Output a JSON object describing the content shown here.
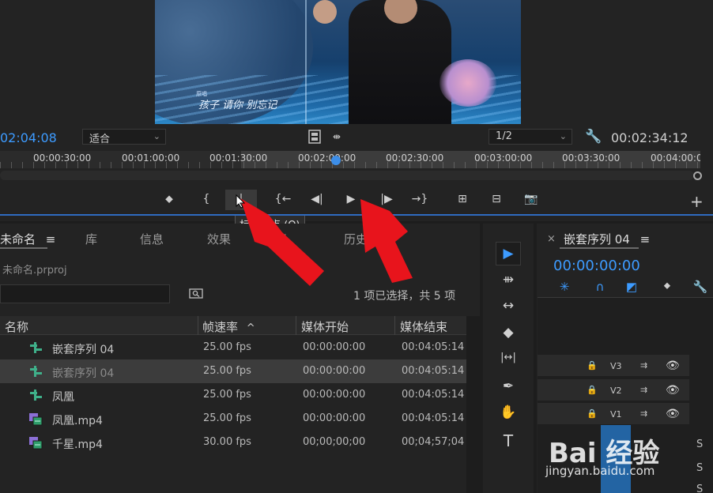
{
  "monitor": {
    "timecode_left": "02:04:08",
    "fit_value": "适合",
    "resolution_value": "1/2",
    "timecode_right": "00:02:34:12",
    "video": {
      "lyric": "孩子 请你 别忘记",
      "lyric_small": "原唱"
    },
    "ruler_ticks": [
      "00:00:30:00",
      "00:01:00:00",
      "00:01:30:00",
      "00:02:00:00",
      "00:02:30:00",
      "00:03:00:00",
      "00:03:30:00",
      "00:04:00:00"
    ],
    "playhead_fraction": 0.48,
    "toolbar": {
      "add_marker": "⬥",
      "mark_in": "{",
      "mark_out": "|",
      "go_to_in": "{←",
      "step_back": "◀|",
      "play": "▶",
      "step_forward": "|▶",
      "go_to_out": "→}",
      "insert": "⊞",
      "overwrite": "⊟",
      "export_frame": "📷",
      "plus": "+"
    },
    "tooltip": "标记出点 (O)"
  },
  "project": {
    "tabs": [
      {
        "label": "未命名",
        "menu": "≡"
      },
      {
        "label": "库"
      },
      {
        "label": "信息"
      },
      {
        "label": "效果"
      },
      {
        "label": "标"
      },
      {
        "label": "历史"
      }
    ],
    "file_name": "未命名.prproj",
    "selection_status": "1 项已选择，共 5 项",
    "columns": [
      "名称",
      "帧速率",
      "媒体开始",
      "媒体结束"
    ],
    "sort_indicator": "^",
    "rows": [
      {
        "name": "嵌套序列 04",
        "fps": "25.00 fps",
        "start": "00:00:00:00",
        "end": "00:04:05:14",
        "type": "sequence",
        "selected": false
      },
      {
        "name": "嵌套序列 04",
        "fps": "25.00 fps",
        "start": "00:00:00:00",
        "end": "00:04:05:14",
        "type": "sequence",
        "selected": true
      },
      {
        "name": "凤凰",
        "fps": "25.00 fps",
        "start": "00:00:00:00",
        "end": "00:04:05:14",
        "type": "sequence",
        "selected": false
      },
      {
        "name": "凤凰.mp4",
        "fps": "25.00 fps",
        "start": "00:00:00:00",
        "end": "00:04:05:14",
        "type": "clip",
        "selected": false
      },
      {
        "name": "千星.mp4",
        "fps": "30.00 fps",
        "start": "00;00;00;00",
        "end": "00;04;57;04",
        "type": "clip",
        "selected": false
      }
    ]
  },
  "tools": [
    "▶",
    "⇻",
    "↔",
    "◆",
    "|↔|",
    "✒",
    "✋",
    "T"
  ],
  "timeline": {
    "close": "×",
    "title": "嵌套序列 04",
    "menu": "≡",
    "timecode": "00:00:00:00",
    "tracks": [
      {
        "name": "V3"
      },
      {
        "name": "V2"
      },
      {
        "name": "V1"
      }
    ],
    "audio_labels": [
      "S",
      "S",
      "S"
    ]
  },
  "watermark": {
    "logo": "Bai 经验",
    "url": "jingyan.baidu.com"
  },
  "colors": {
    "accent": "#3d9bff",
    "annotation": "#e8141c",
    "selection": "#3c3c3c"
  }
}
